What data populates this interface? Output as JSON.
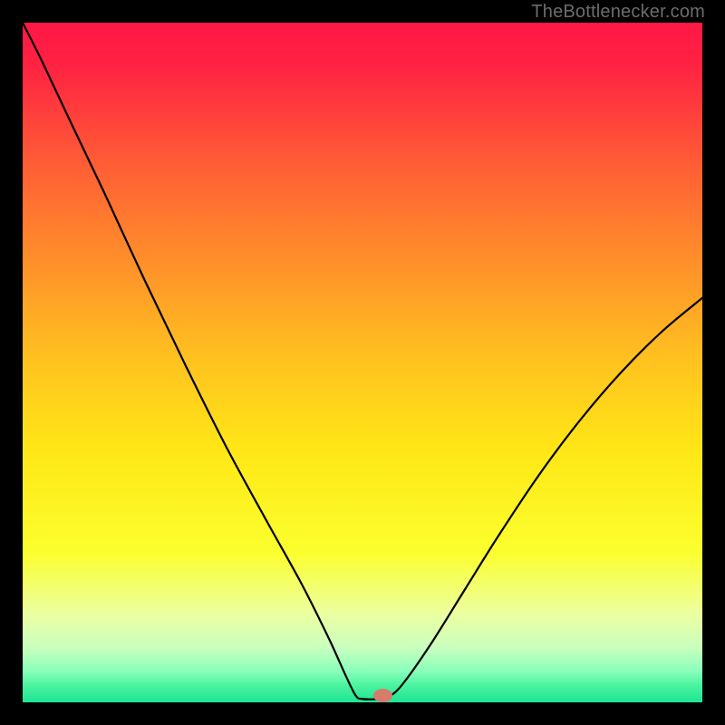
{
  "watermark": "TheBottlenecker.com",
  "chart_data": {
    "type": "line",
    "title": "",
    "xlabel": "",
    "ylabel": "",
    "xlim": [
      0,
      100
    ],
    "ylim": [
      0,
      100
    ],
    "background_gradient_stops": [
      {
        "offset": 0.0,
        "color": "#ff1846"
      },
      {
        "offset": 0.06,
        "color": "#ff2142"
      },
      {
        "offset": 0.2,
        "color": "#ff5a36"
      },
      {
        "offset": 0.35,
        "color": "#ff8f2a"
      },
      {
        "offset": 0.5,
        "color": "#ffc31f"
      },
      {
        "offset": 0.63,
        "color": "#ffe716"
      },
      {
        "offset": 0.78,
        "color": "#fbff2e"
      },
      {
        "offset": 0.87,
        "color": "#ecffa1"
      },
      {
        "offset": 0.92,
        "color": "#c9ffbf"
      },
      {
        "offset": 0.955,
        "color": "#87ffba"
      },
      {
        "offset": 0.975,
        "color": "#4bf39f"
      },
      {
        "offset": 1.0,
        "color": "#1de592"
      }
    ],
    "curve": {
      "description": "V-shaped bottleneck curve: steep descent from top-left, flat minimum near x≈50, rising convex branch to right edge",
      "points": [
        {
          "x": 0.0,
          "y": 100.0
        },
        {
          "x": 3.0,
          "y": 94.0
        },
        {
          "x": 7.0,
          "y": 85.5
        },
        {
          "x": 12.0,
          "y": 75.0
        },
        {
          "x": 18.0,
          "y": 62.0
        },
        {
          "x": 24.0,
          "y": 49.5
        },
        {
          "x": 30.0,
          "y": 37.5
        },
        {
          "x": 36.0,
          "y": 26.5
        },
        {
          "x": 41.0,
          "y": 17.5
        },
        {
          "x": 45.0,
          "y": 9.5
        },
        {
          "x": 47.5,
          "y": 4.0
        },
        {
          "x": 49.0,
          "y": 1.0
        },
        {
          "x": 50.0,
          "y": 0.5
        },
        {
          "x": 52.5,
          "y": 0.5
        },
        {
          "x": 54.0,
          "y": 0.9
        },
        {
          "x": 56.0,
          "y": 2.8
        },
        {
          "x": 60.0,
          "y": 8.5
        },
        {
          "x": 65.0,
          "y": 16.5
        },
        {
          "x": 70.0,
          "y": 24.5
        },
        {
          "x": 76.0,
          "y": 33.5
        },
        {
          "x": 82.0,
          "y": 41.5
        },
        {
          "x": 88.0,
          "y": 48.5
        },
        {
          "x": 94.0,
          "y": 54.5
        },
        {
          "x": 100.0,
          "y": 59.5
        }
      ]
    },
    "marker": {
      "x": 53.0,
      "y": 1.0,
      "rx": 1.4,
      "ry": 1.0,
      "color": "#d87a6c"
    }
  }
}
